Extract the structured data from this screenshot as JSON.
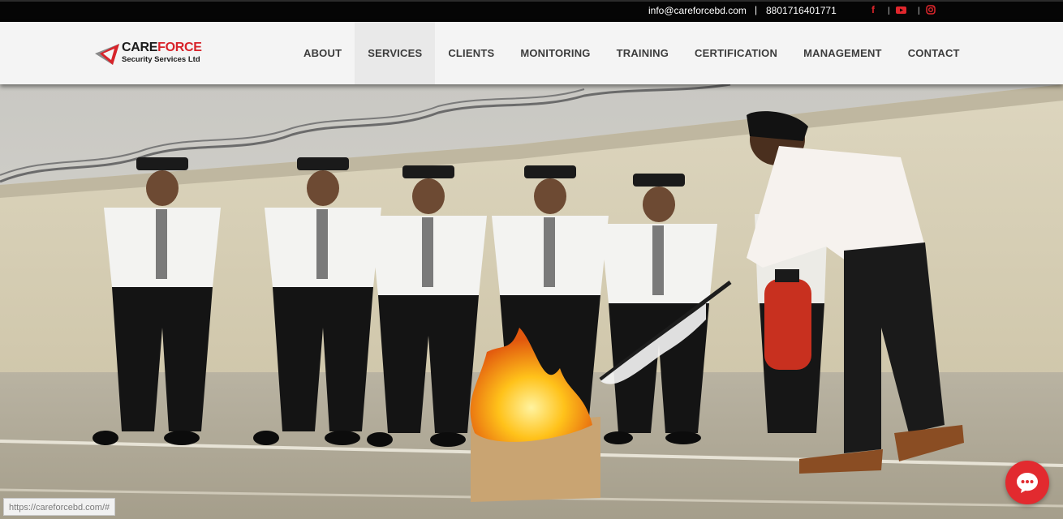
{
  "topbar": {
    "email": "info@careforcebd.com",
    "separator": "|",
    "phone": "8801716401771",
    "social_icons": [
      "facebook-icon",
      "youtube-icon",
      "instagram-icon"
    ]
  },
  "logo": {
    "name_part1": "CARE",
    "name_part2": "FORCE",
    "subtitle": "Security Services Ltd"
  },
  "nav": {
    "items": [
      "ABOUT",
      "SERVICES",
      "CLIENTS",
      "MONITORING",
      "TRAINING",
      "CERTIFICATION",
      "MANAGEMENT",
      "CONTACT"
    ],
    "active": "SERVICES"
  },
  "status_url": "https://careforcebd.com/#",
  "colors": {
    "brand_red": "#e0262c",
    "topbar": "#050505",
    "header": "#f4f4f4"
  }
}
